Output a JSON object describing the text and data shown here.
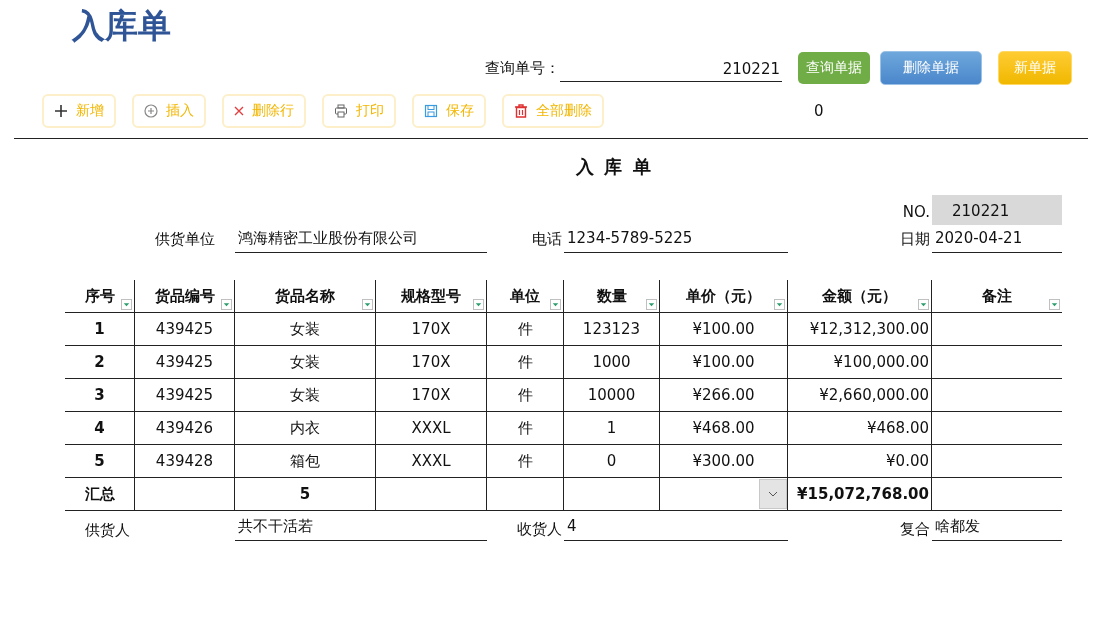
{
  "title": "入库单",
  "query": {
    "label": "查询单号：",
    "value": "210221"
  },
  "buttons": [
    {
      "label": "查询单据",
      "kind": "query"
    },
    {
      "label": "删除单据",
      "kind": "delete"
    },
    {
      "label": "新单据",
      "kind": "new"
    }
  ],
  "toolbar": [
    {
      "label": "新增",
      "kind": "add"
    },
    {
      "label": "插入",
      "kind": "insert"
    },
    {
      "label": "删除行",
      "kind": "remove"
    },
    {
      "label": "打印",
      "kind": "print"
    },
    {
      "label": "保存",
      "kind": "save"
    },
    {
      "label": "全部删除",
      "kind": "clear"
    }
  ],
  "counter": "0",
  "form": {
    "title": "入 库 单",
    "no_label": "NO.",
    "no": "210221",
    "supplier_label": "供货单位",
    "supplier": "鸿海精密工业股份有限公司",
    "phone_label": "电话",
    "phone": "1234-5789-5225",
    "date_label": "日期",
    "date": "2020-04-21"
  },
  "table": {
    "columns": [
      "序号",
      "货品编号",
      "货品名称",
      "规格型号",
      "单位",
      "数量",
      "单价（元）",
      "金额（元）",
      "备注"
    ],
    "rows": [
      [
        "1",
        "439425",
        "女装",
        "170X",
        "件",
        "123123",
        "¥100.00",
        "¥12,312,300.00"
      ],
      [
        "2",
        "439425",
        "女装",
        "170X",
        "件",
        "1000",
        "¥100.00",
        "¥100,000.00"
      ],
      [
        "3",
        "439425",
        "女装",
        "170X",
        "件",
        "10000",
        "¥266.00",
        "¥2,660,000.00"
      ],
      [
        "4",
        "439426",
        "内衣",
        "XXXL",
        "件",
        "1",
        "¥468.00",
        "¥468.00"
      ],
      [
        "5",
        "439428",
        "箱包",
        "XXXL",
        "件",
        "0",
        "¥300.00",
        "¥0.00"
      ]
    ],
    "total": {
      "label": "汇总",
      "count": "5",
      "amount": "¥15,072,768.00"
    }
  },
  "footer": {
    "supplier_label": "供货人",
    "supplier": "共不干活若",
    "receiver_label": "收货人",
    "receiver": "4",
    "checker_label": "复合",
    "checker": "啥都发"
  }
}
